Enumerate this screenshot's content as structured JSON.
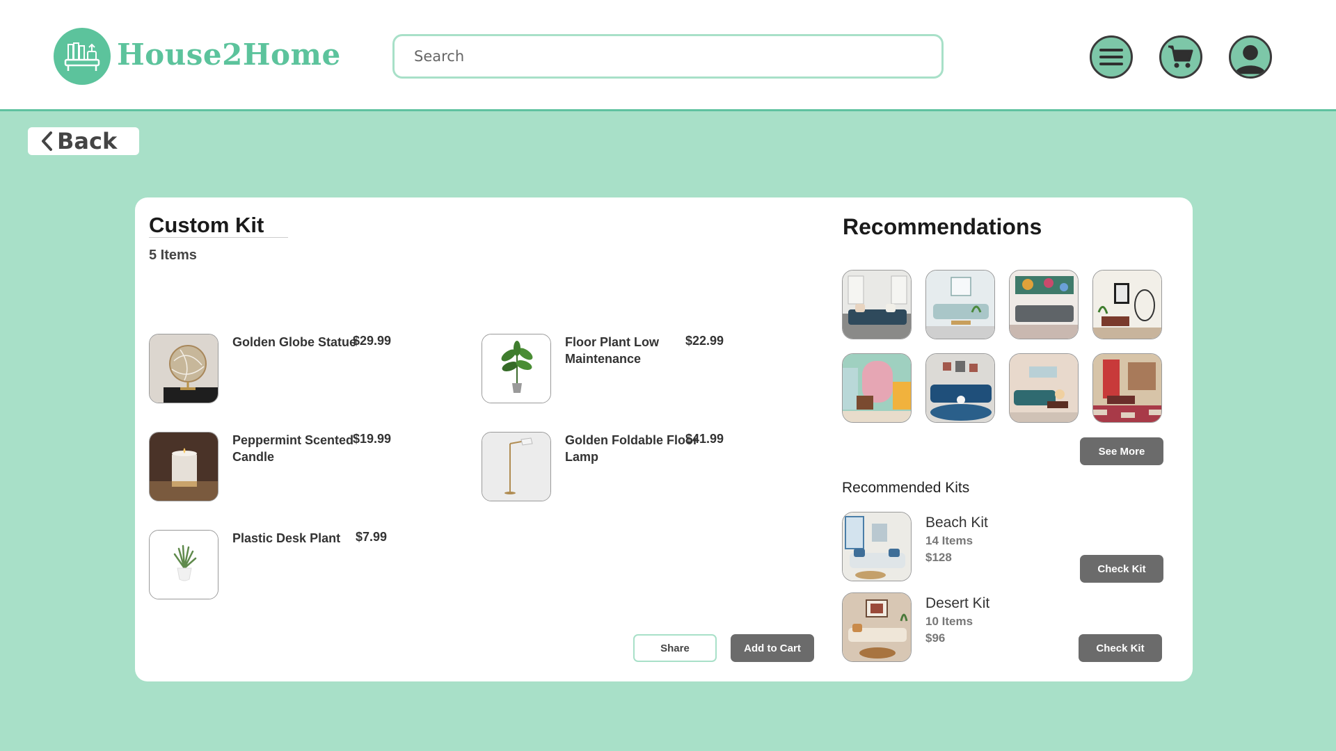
{
  "header": {
    "brand": "House2Home",
    "search_placeholder": "Search",
    "icons": [
      "logo-icon",
      "menu-icon",
      "cart-icon",
      "profile-icon"
    ]
  },
  "back": {
    "label": "Back"
  },
  "kit": {
    "title": "Custom Kit",
    "count": "5 Items",
    "items": [
      {
        "name": "Golden Globe Statue",
        "price": "$29.99"
      },
      {
        "name": "Floor Plant Low Maintenance",
        "price": "$22.99"
      },
      {
        "name": "Peppermint Scented Candle",
        "price": "$19.99"
      },
      {
        "name": "Golden Foldable Floor Lamp",
        "price": "$41.99"
      },
      {
        "name": "Plastic Desk Plant",
        "price": "$7.99"
      }
    ],
    "share_label": "Share",
    "add_to_cart_label": "Add to Cart"
  },
  "recommendations": {
    "title": "Recommendations",
    "see_more_label": "See More",
    "kits_title": "Recommended Kits",
    "kits": [
      {
        "name": "Beach Kit",
        "items": "14 Items",
        "price": "$128",
        "button": "Check Kit"
      },
      {
        "name": "Desert Kit",
        "items": "10 Items",
        "price": "$96",
        "button": "Check Kit"
      }
    ]
  },
  "colors": {
    "accent": "#5cc39c",
    "background": "#a8e0c8",
    "dark_button": "#6b6b6b"
  }
}
